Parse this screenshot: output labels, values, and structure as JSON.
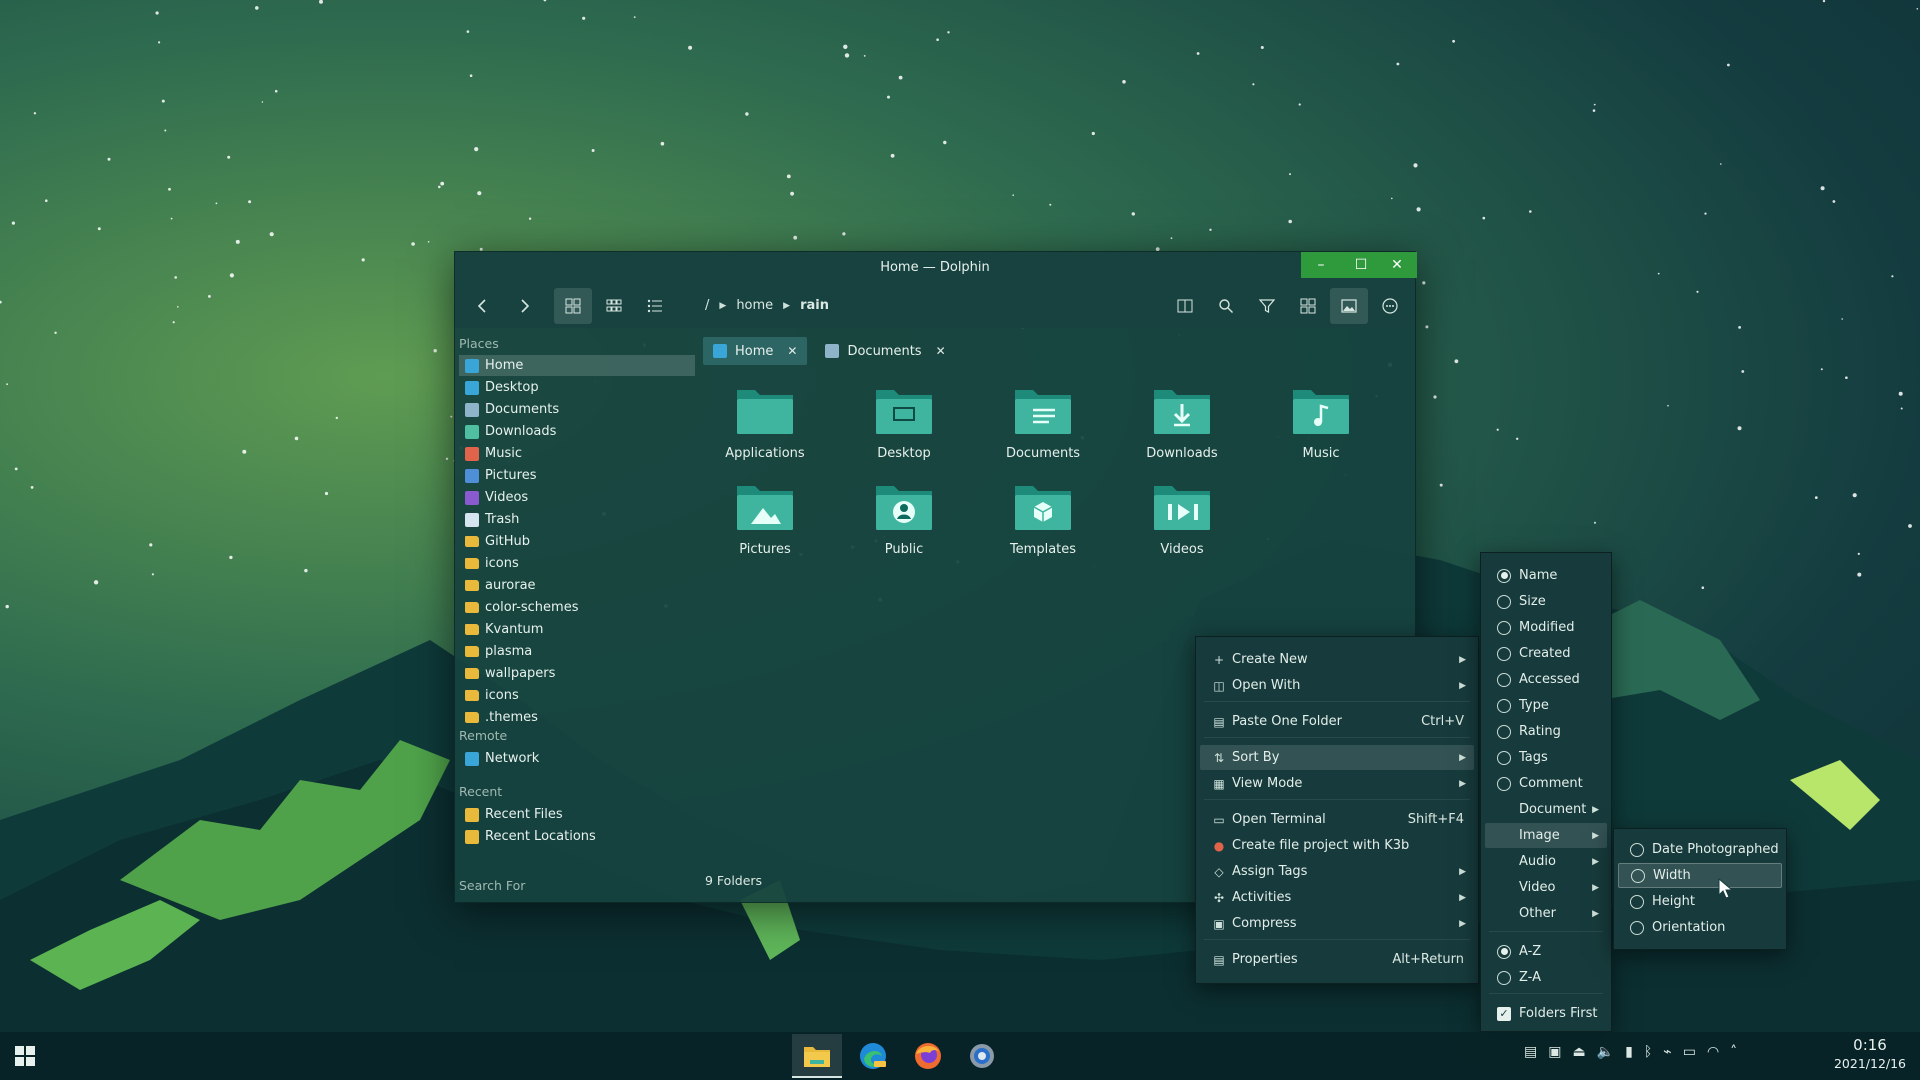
{
  "window": {
    "title": "Home — Dolphin",
    "minimize": "–",
    "maximize": "☐",
    "close": "✕"
  },
  "breadcrumb": {
    "root": "/",
    "home": "home",
    "current": "rain"
  },
  "sidebar": {
    "places_label": "Places",
    "places": [
      {
        "label": "Home",
        "icon": "home-icon",
        "color": "#3aa6d8"
      },
      {
        "label": "Desktop",
        "icon": "desktop-icon",
        "color": "#3aa6d8"
      },
      {
        "label": "Documents",
        "icon": "documents-icon",
        "color": "#8fb3c8"
      },
      {
        "label": "Downloads",
        "icon": "downloads-icon",
        "color": "#4fbfa0"
      },
      {
        "label": "Music",
        "icon": "music-icon",
        "color": "#e0634a"
      },
      {
        "label": "Pictures",
        "icon": "pictures-icon",
        "color": "#4f8fd8"
      },
      {
        "label": "Videos",
        "icon": "videos-icon",
        "color": "#8a5bd0"
      },
      {
        "label": "Trash",
        "icon": "trash-icon",
        "color": "#d6e6f0"
      },
      {
        "label": "GitHub",
        "icon": "folder-icon",
        "color": "#e9b93b"
      },
      {
        "label": "icons",
        "icon": "folder-icon",
        "color": "#e9b93b"
      },
      {
        "label": "aurorae",
        "icon": "folder-icon",
        "color": "#e9b93b"
      },
      {
        "label": "color-schemes",
        "icon": "folder-icon",
        "color": "#e9b93b"
      },
      {
        "label": "Kvantum",
        "icon": "folder-icon",
        "color": "#e9b93b"
      },
      {
        "label": "plasma",
        "icon": "folder-icon",
        "color": "#e9b93b"
      },
      {
        "label": "wallpapers",
        "icon": "folder-icon",
        "color": "#e9b93b"
      },
      {
        "label": "icons",
        "icon": "folder-icon",
        "color": "#e9b93b"
      },
      {
        "label": ".themes",
        "icon": "folder-icon",
        "color": "#e9b93b"
      }
    ],
    "remote_label": "Remote",
    "remote": [
      {
        "label": "Network",
        "icon": "network-icon",
        "color": "#3aa6d8"
      }
    ],
    "recent_label": "Recent",
    "recent": [
      {
        "label": "Recent Files",
        "icon": "recent-files-icon",
        "color": "#e9b93b"
      },
      {
        "label": "Recent Locations",
        "icon": "recent-locations-icon",
        "color": "#e9b93b"
      }
    ],
    "search_label": "Search For"
  },
  "tabs": [
    {
      "label": "Home",
      "icon": "home-icon",
      "active": true
    },
    {
      "label": "Documents",
      "icon": "documents-icon",
      "active": false
    }
  ],
  "folders": [
    {
      "label": "Applications",
      "icon": "folder-applications-icon"
    },
    {
      "label": "Desktop",
      "icon": "folder-desktop-icon"
    },
    {
      "label": "Documents",
      "icon": "folder-documents-icon"
    },
    {
      "label": "Downloads",
      "icon": "folder-downloads-icon"
    },
    {
      "label": "Music",
      "icon": "folder-music-icon"
    },
    {
      "label": "Pictures",
      "icon": "folder-pictures-icon"
    },
    {
      "label": "Public",
      "icon": "folder-public-icon"
    },
    {
      "label": "Templates",
      "icon": "folder-templates-icon"
    },
    {
      "label": "Videos",
      "icon": "folder-videos-icon"
    }
  ],
  "status": "9 Folders",
  "context_menu": {
    "create_new": "Create New",
    "open_with": "Open With",
    "paste": "Paste One Folder",
    "paste_shortcut": "Ctrl+V",
    "sort_by": "Sort By",
    "view_mode": "View Mode",
    "open_terminal": "Open Terminal",
    "open_terminal_shortcut": "Shift+F4",
    "k3b": "Create file project with K3b",
    "assign_tags": "Assign Tags",
    "activities": "Activities",
    "compress": "Compress",
    "properties": "Properties",
    "properties_shortcut": "Alt+Return"
  },
  "sort_menu": {
    "name": "Name",
    "size": "Size",
    "modified": "Modified",
    "created": "Created",
    "accessed": "Accessed",
    "type": "Type",
    "rating": "Rating",
    "tags": "Tags",
    "comment": "Comment",
    "document": "Document",
    "image": "Image",
    "audio": "Audio",
    "video": "Video",
    "other": "Other",
    "az": "A-Z",
    "za": "Z-A",
    "folders_first": "Folders First"
  },
  "image_menu": {
    "date_photographed": "Date Photographed",
    "width": "Width",
    "height": "Height",
    "orientation": "Orientation"
  },
  "clock": {
    "time": "0:16",
    "date": "2021/12/16"
  },
  "colors": {
    "accent": "#2f9a3c",
    "folder_teal": "#3fb5a0"
  }
}
